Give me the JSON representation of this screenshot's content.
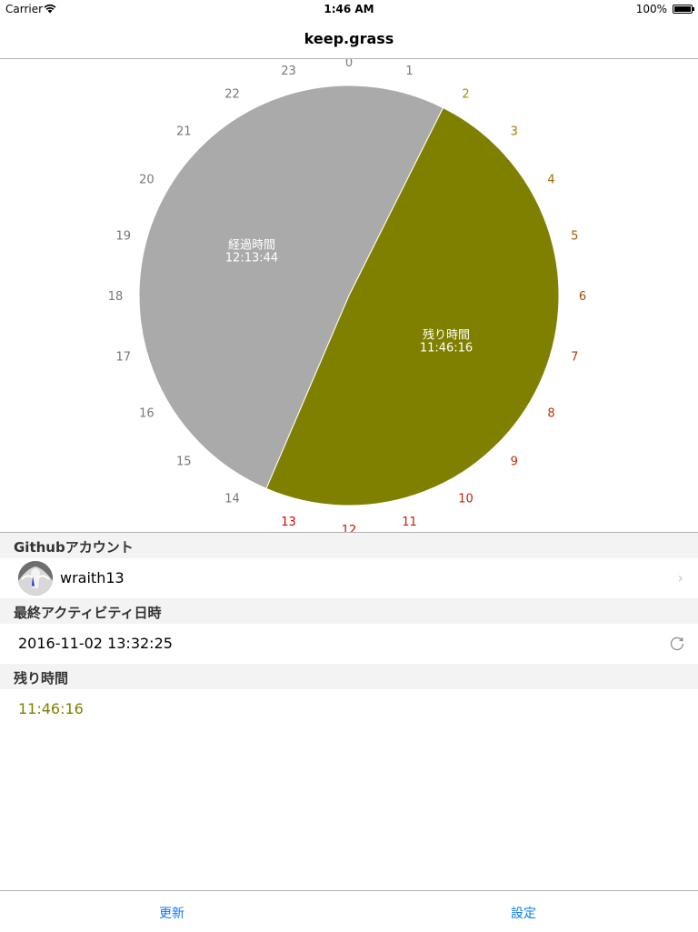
{
  "status_bar": {
    "carrier": "Carrier",
    "time": "1:46 AM",
    "battery": "100%"
  },
  "nav": {
    "title": "keep.grass"
  },
  "chart_data": {
    "type": "pie",
    "hour_labels": [
      "0",
      "1",
      "2",
      "3",
      "4",
      "5",
      "6",
      "7",
      "8",
      "9",
      "10",
      "11",
      "12",
      "13",
      "14",
      "15",
      "16",
      "17",
      "18",
      "19",
      "20",
      "21",
      "22",
      "23"
    ],
    "slices": [
      {
        "name": "経過時間",
        "value_text": "12:13:44",
        "hours": 12.2289,
        "color": "#aaaaaa"
      },
      {
        "name": "残り時間",
        "value_text": "11:46:16",
        "hours": 11.7711,
        "color": "#808000"
      }
    ],
    "start_hour": 13.5465,
    "remaining_label_colors": {
      "2": "#a09000",
      "3": "#a07a00",
      "4": "#a06a00",
      "5": "#a05a00",
      "6": "#a04c00",
      "7": "#a04000",
      "8": "#b03800",
      "9": "#b83000",
      "10": "#c02400",
      "11": "#c81a00",
      "12": "#d01000",
      "13": "#e00000"
    }
  },
  "sections": {
    "account_header": "Githubアカウント",
    "account_name": "wraith13",
    "activity_header": "最終アクティビティ日時",
    "activity_value": "2016-11-02 13:32:25",
    "remaining_header": "残り時間",
    "remaining_value": "11:46:16",
    "remaining_color": "#808000"
  },
  "tabs": {
    "update": "更新",
    "settings": "設定"
  },
  "colors": {
    "accent": "#0a7aff"
  }
}
